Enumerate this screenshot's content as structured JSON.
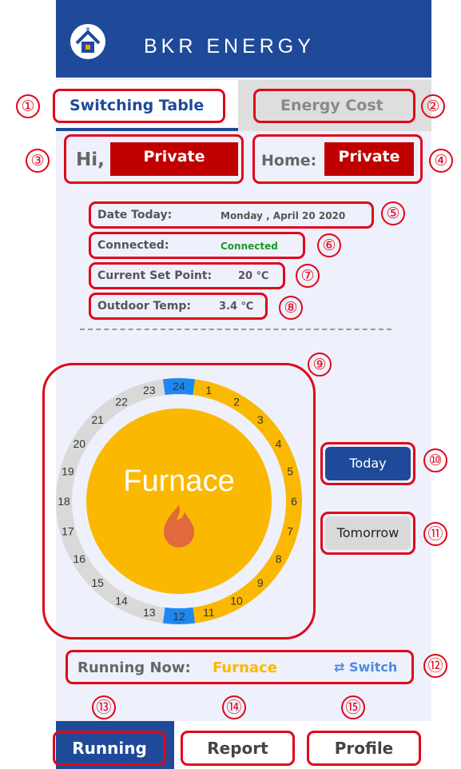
{
  "header": {
    "brand": "BKR ENERGY"
  },
  "tabs": {
    "switching": "Switching Table",
    "energy": "Energy Cost"
  },
  "greeting": {
    "hi": "Hi,",
    "user": "Private",
    "home_label": "Home:",
    "home_value": "Private"
  },
  "info": {
    "date_label": "Date Today:",
    "date_value": "Monday , April 20 2020",
    "connected_label": "Connected:",
    "connected_value": "Connected",
    "setpoint_label": "Current Set Point:",
    "setpoint_value": "20 ℃",
    "outdoor_label": "Outdoor Temp:",
    "outdoor_value": "3.4 ℃"
  },
  "dial": {
    "center_label": "Furnace",
    "hours": [
      "1",
      "2",
      "3",
      "4",
      "5",
      "6",
      "7",
      "8",
      "9",
      "10",
      "11",
      "12",
      "13",
      "14",
      "15",
      "16",
      "17",
      "18",
      "19",
      "20",
      "21",
      "22",
      "23",
      "24"
    ]
  },
  "buttons": {
    "today": "Today",
    "tomorrow": "Tomorrow"
  },
  "running": {
    "label": "Running Now:",
    "value": "Furnace",
    "switch": "Switch"
  },
  "nav": {
    "running": "Running",
    "report": "Report",
    "profile": "Profile"
  },
  "markers": [
    "①",
    "②",
    "③",
    "④",
    "⑤",
    "⑥",
    "⑦",
    "⑧",
    "⑨",
    "⑩",
    "⑪",
    "⑫",
    "⑬",
    "⑭",
    "⑮"
  ],
  "colors": {
    "brand_blue": "#1f4a99",
    "furnace_yellow": "#fbb800",
    "highlight_red": "#e0061a",
    "segment_blue": "#1e88f0",
    "connected_green": "#1a9a2a"
  }
}
